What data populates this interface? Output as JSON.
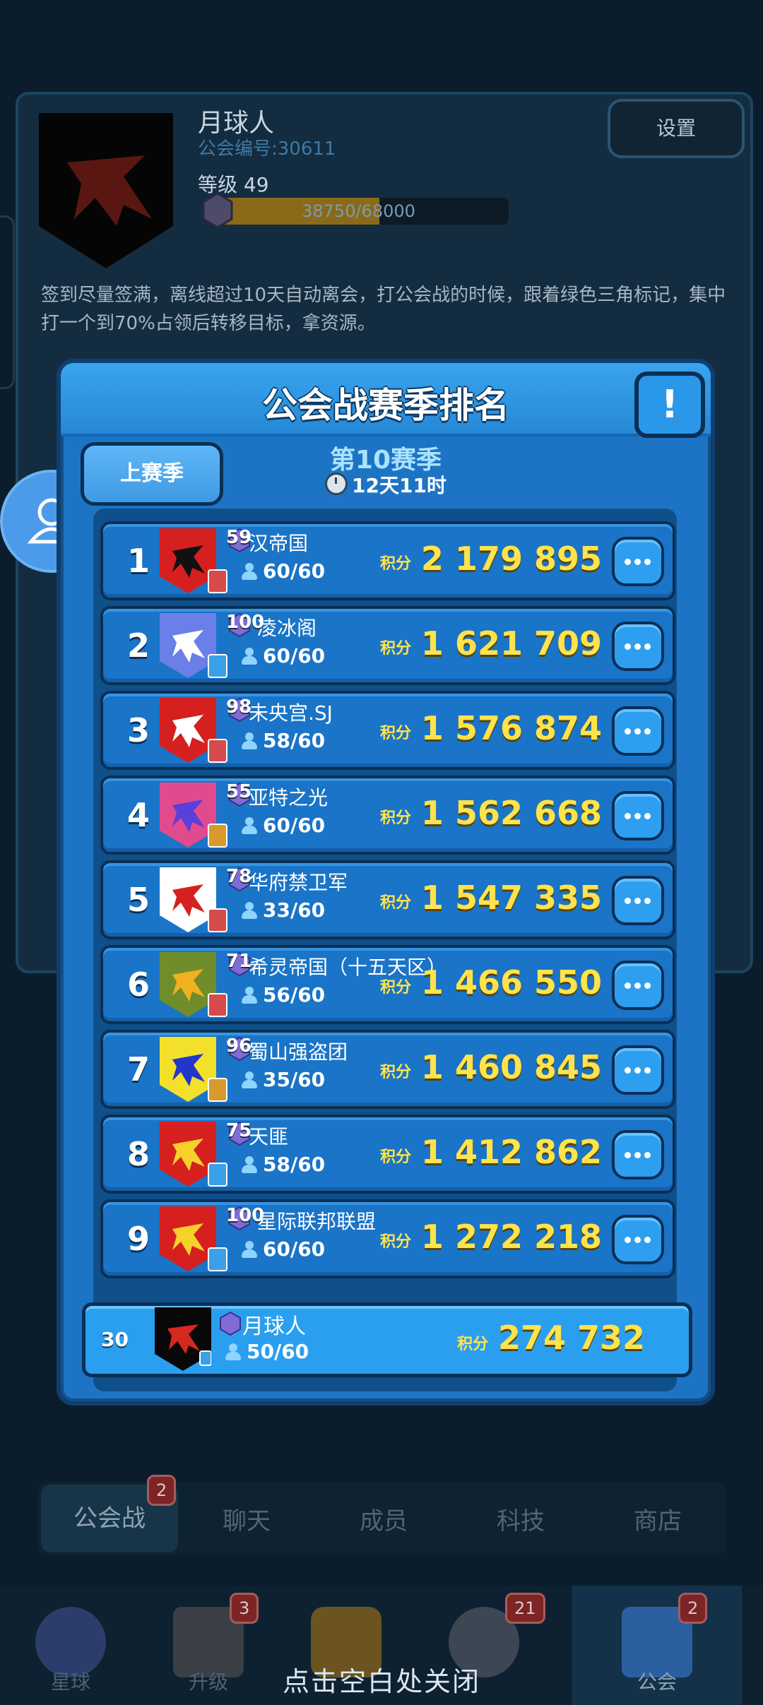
{
  "background": {
    "player_name": "月球人",
    "guild_number": "公会编号:30611",
    "level": "等级 49",
    "xp_text": "38750/68000",
    "xp_fraction": 0.57,
    "settings_label": "设置",
    "notice": "签到尽量签满，离线超过10天自动离会，打公会战的时候，跟着绿色三角标记，集中打一个到70%占领后转移目标，拿资源。",
    "tabs": [
      {
        "label": "公会战",
        "badge": "2"
      },
      {
        "label": "聊天"
      },
      {
        "label": "成员"
      },
      {
        "label": "科技"
      },
      {
        "label": "商店"
      }
    ],
    "nav": [
      {
        "label": "星球",
        "icon": "planet-icon"
      },
      {
        "label": "升级",
        "icon": "tools-icon",
        "badge": "3"
      },
      {
        "label": "",
        "icon": "shield-icon"
      },
      {
        "label": "",
        "icon": "base-icon",
        "badge": "21"
      },
      {
        "label": "公会",
        "icon": "guild-icon",
        "badge": "2"
      }
    ],
    "close_hint": "点击空白处关闭"
  },
  "modal": {
    "title": "公会战赛季排名",
    "info_label": "!",
    "prev_season_label": "上赛季",
    "season_title": "第10赛季",
    "season_timer": "12天11时",
    "score_label": "积分",
    "rows": [
      {
        "rank": "1",
        "level": "59",
        "name": "汉帝国",
        "members": "60/60",
        "score": "2 179 895",
        "emblem_bg": "#d6201f",
        "emblem_fg": "#111111",
        "badge_color": "#d64b4b"
      },
      {
        "rank": "2",
        "level": "100",
        "name": "凌冰阁",
        "members": "60/60",
        "score": "1 621 709",
        "emblem_bg": "#6a7fe8",
        "emblem_fg": "#ffffff",
        "badge_color": "#3aa0e8"
      },
      {
        "rank": "3",
        "level": "98",
        "name": "未央宫.SJ",
        "members": "58/60",
        "score": "1 576 874",
        "emblem_bg": "#d6201f",
        "emblem_fg": "#ffffff",
        "badge_color": "#d64b4b"
      },
      {
        "rank": "4",
        "level": "55",
        "name": "亚特之光",
        "members": "60/60",
        "score": "1 562 668",
        "emblem_bg": "#e14a8d",
        "emblem_fg": "#5a3fd8",
        "badge_color": "#d89a2c"
      },
      {
        "rank": "5",
        "level": "78",
        "name": "华府禁卫军",
        "members": "33/60",
        "score": "1 547 335",
        "emblem_bg": "#ffffff",
        "emblem_fg": "#d6201f",
        "badge_color": "#d64b4b"
      },
      {
        "rank": "6",
        "level": "71",
        "name": "希灵帝国（十五天区）",
        "members": "56/60",
        "score": "1 466 550",
        "emblem_bg": "#6f8d2a",
        "emblem_fg": "#f0b020",
        "badge_color": "#d64b4b"
      },
      {
        "rank": "7",
        "level": "96",
        "name": "蜀山强盗团",
        "members": "35/60",
        "score": "1 460 845",
        "emblem_bg": "#f3e02a",
        "emblem_fg": "#2237c8",
        "badge_color": "#d89a2c"
      },
      {
        "rank": "8",
        "level": "75",
        "name": "天匪",
        "members": "58/60",
        "score": "1 412 862",
        "emblem_bg": "#d6201f",
        "emblem_fg": "#f5d12a",
        "badge_color": "#3aa0e8"
      },
      {
        "rank": "9",
        "level": "100",
        "name": "星际联邦联盟",
        "members": "60/60",
        "score": "1 272 218",
        "emblem_bg": "#d6201f",
        "emblem_fg": "#f5d12a",
        "badge_color": "#3aa0e8"
      }
    ],
    "my_guild": {
      "rank": "30",
      "name": "月球人",
      "members": "50/60",
      "score": "274 732"
    }
  }
}
